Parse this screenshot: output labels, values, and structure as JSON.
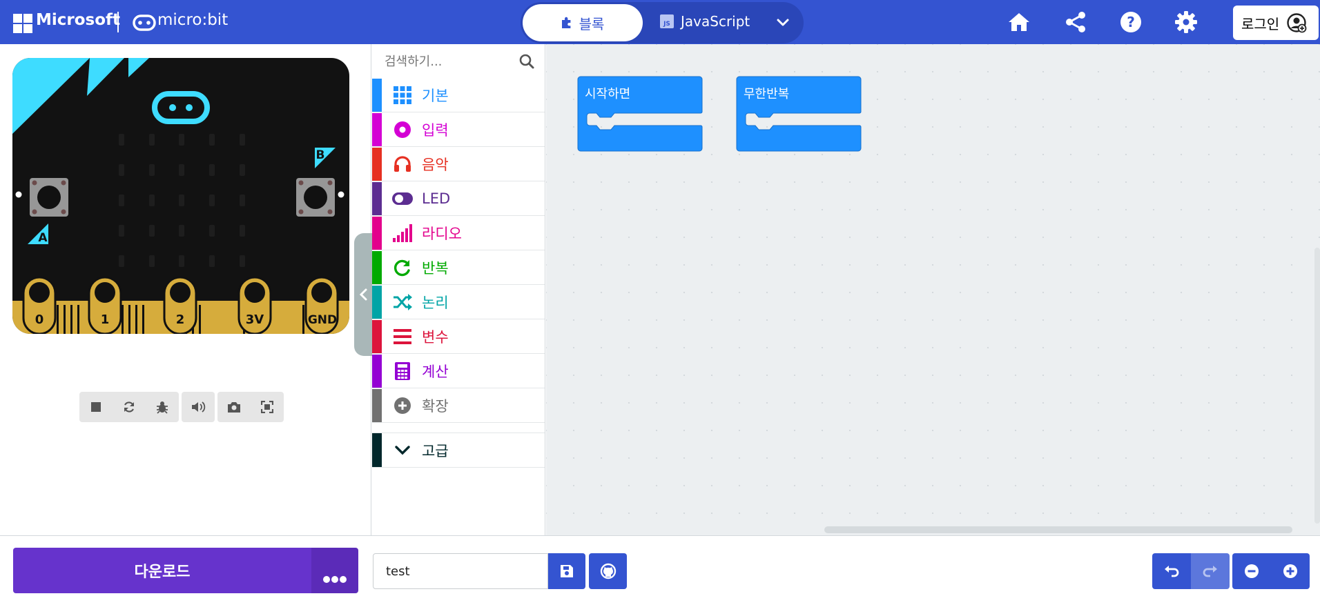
{
  "header": {
    "brand": "Microsoft",
    "product": "micro:bit",
    "tab_blocks": "블록",
    "tab_js": "JavaScript",
    "js_badge": "JS",
    "login": "로그인",
    "icons": [
      "home-icon",
      "share-icon",
      "help-icon",
      "settings-icon"
    ]
  },
  "simulator": {
    "pin_labels": [
      "0",
      "1",
      "2",
      "3V",
      "GND"
    ],
    "button_a": "A",
    "button_b": "B"
  },
  "toolbox": {
    "search_placeholder": "검색하기...",
    "categories": [
      {
        "label": "기본",
        "color": "#1e90ff",
        "icon": "grid-icon"
      },
      {
        "label": "입력",
        "color": "#d400d4",
        "icon": "input-icon"
      },
      {
        "label": "음악",
        "color": "#e63022",
        "icon": "headphones-icon"
      },
      {
        "label": "LED",
        "color": "#5c2d91",
        "icon": "toggle-icon"
      },
      {
        "label": "라디오",
        "color": "#e3008c",
        "icon": "signal-icon"
      },
      {
        "label": "반복",
        "color": "#00aa00",
        "icon": "loop-icon"
      },
      {
        "label": "논리",
        "color": "#00a4a6",
        "icon": "shuffle-icon"
      },
      {
        "label": "변수",
        "color": "#dc143c",
        "icon": "list-icon"
      },
      {
        "label": "계산",
        "color": "#9400d3",
        "icon": "calculator-icon"
      },
      {
        "label": "확장",
        "color": "#717171",
        "icon": "plus-circle-icon"
      }
    ],
    "advanced": {
      "label": "고급",
      "color": "#00272b"
    }
  },
  "workspace": {
    "blocks": [
      {
        "label": "시작하면"
      },
      {
        "label": "무한반복"
      }
    ],
    "block_color": "#1e90ff"
  },
  "bottom": {
    "download": "다운로드",
    "project_name": "test"
  }
}
